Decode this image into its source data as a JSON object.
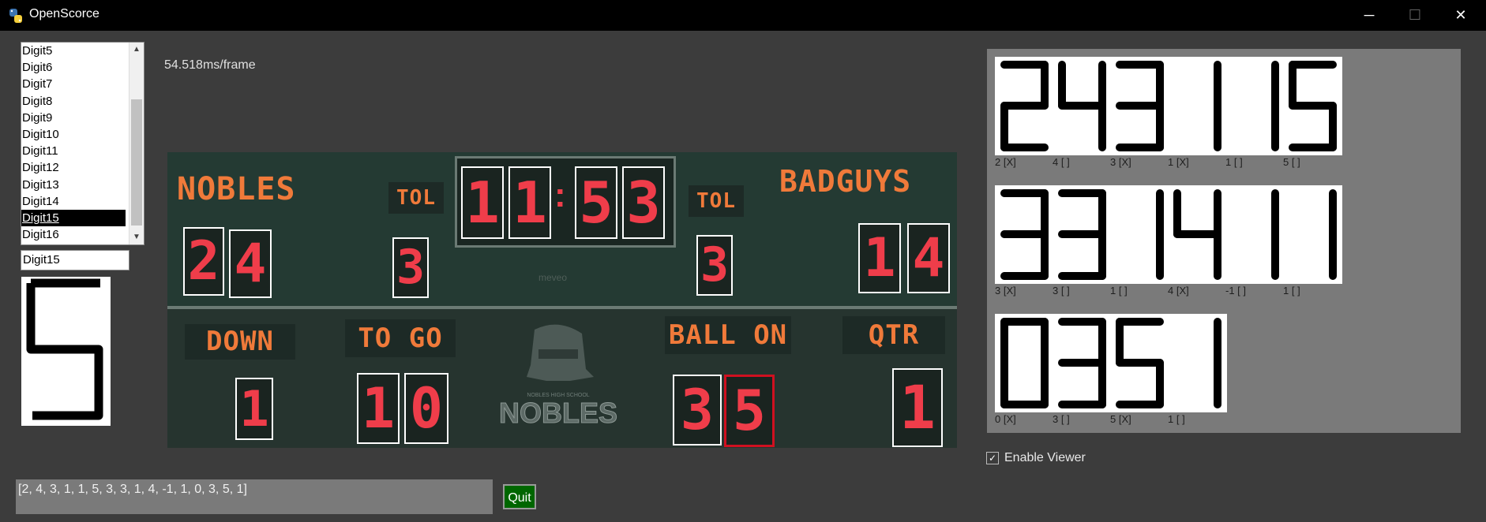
{
  "window": {
    "title": "OpenScorce",
    "minimize": "─",
    "maximize": "☐",
    "close": "✕"
  },
  "digit_list": {
    "items": [
      "Digit5",
      "Digit6",
      "Digit7",
      "Digit8",
      "Digit9",
      "Digit10",
      "Digit11",
      "Digit12",
      "Digit13",
      "Digit14",
      "Digit15",
      "Digit16"
    ],
    "selected": "Digit15",
    "scroll_up": "▲",
    "scroll_down": "▼"
  },
  "selected_name": "Digit15",
  "performance": "54.518ms/frame",
  "scoreboard": {
    "home_name": "NOBLES",
    "away_name": "BADGUYS",
    "tol_label": "TOL",
    "home_score": [
      "2",
      "4"
    ],
    "away_score": [
      "1",
      "4"
    ],
    "home_tol": "3",
    "away_tol": "3",
    "clock": [
      "1",
      "1",
      "5",
      "3"
    ],
    "colon": ":",
    "down_label": "DOWN",
    "togo_label": "TO GO",
    "ballon_label": "BALL ON",
    "qtr_label": "QTR",
    "down": "1",
    "togo": [
      "1",
      "0"
    ],
    "ballon": [
      "3",
      "5"
    ],
    "qtr": "1",
    "logo_text": "NOBLES",
    "logo_sub": "NOBLES HIGH SCHOOL",
    "watermark": "meveo"
  },
  "digit_viewer": {
    "cells": [
      {
        "digit": "2",
        "caption": "2 [X]"
      },
      {
        "digit": "4",
        "caption": "4 [ ]"
      },
      {
        "digit": "3",
        "caption": "3 [X]"
      },
      {
        "digit": "1",
        "caption": "1 [X]"
      },
      {
        "digit": "1",
        "caption": "1 [ ]"
      },
      {
        "digit": "5",
        "caption": "5 [ ]"
      },
      {
        "digit": "3",
        "caption": "3 [X]"
      },
      {
        "digit": "3",
        "caption": "3 [ ]"
      },
      {
        "digit": "1",
        "caption": "1 [ ]"
      },
      {
        "digit": "4",
        "caption": "4 [X]"
      },
      {
        "digit": "1",
        "caption": "-1 [ ]"
      },
      {
        "digit": "1",
        "caption": "1 [ ]"
      },
      {
        "digit": "0",
        "caption": "0 [X]"
      },
      {
        "digit": "3",
        "caption": "3 [ ]"
      },
      {
        "digit": "5",
        "caption": "5 [X]"
      },
      {
        "digit": "1",
        "caption": "1 [ ]"
      }
    ]
  },
  "enable_viewer": {
    "label": "Enable Viewer",
    "checked": true,
    "check_mark": "✓"
  },
  "output_text": "[2, 4, 3, 1, 1, 5, 3, 3, 1, 4, -1, 1, 0, 3, 5, 1]",
  "quit_label": "Quit",
  "colors": {
    "led_red": "#ef3d4a",
    "label_orange": "#f07a3a",
    "board_green": "#243a33",
    "quit_green": "#006600"
  }
}
